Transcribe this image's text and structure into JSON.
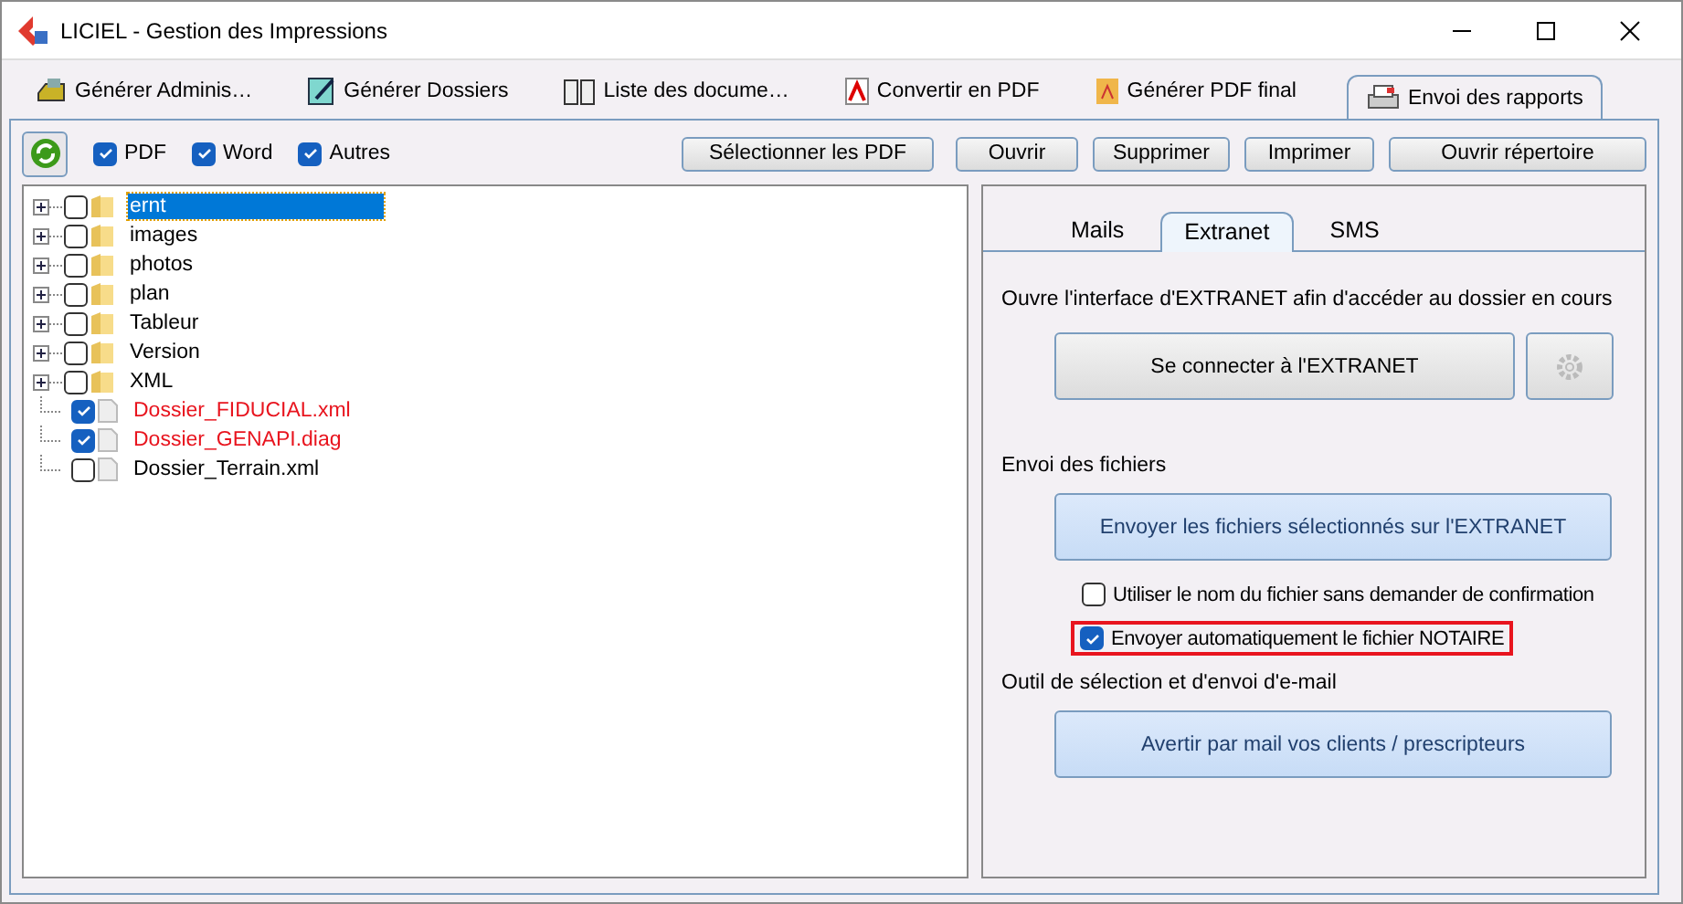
{
  "window": {
    "title": "LICIEL - Gestion des Impressions"
  },
  "tabs": [
    {
      "label": "Générer Adminis…",
      "selected": false
    },
    {
      "label": "Générer Dossiers",
      "selected": false
    },
    {
      "label": "Liste des docume…",
      "selected": false
    },
    {
      "label": "Convertir en PDF",
      "selected": false
    },
    {
      "label": "Générer PDF final",
      "selected": false
    },
    {
      "label": "Envoi des rapports",
      "selected": true
    }
  ],
  "filters": [
    {
      "label": "PDF",
      "checked": true
    },
    {
      "label": "Word",
      "checked": true
    },
    {
      "label": "Autres",
      "checked": true
    }
  ],
  "toolbar_buttons": [
    "Sélectionner les PDF",
    "Ouvrir",
    "Supprimer",
    "Imprimer",
    "Ouvrir répertoire"
  ],
  "tree": [
    {
      "kind": "folder",
      "label": "ernt",
      "checked": false,
      "selected": true,
      "flagged": false
    },
    {
      "kind": "folder",
      "label": "images",
      "checked": false,
      "selected": false,
      "flagged": false
    },
    {
      "kind": "folder",
      "label": "photos",
      "checked": false,
      "selected": false,
      "flagged": false
    },
    {
      "kind": "folder",
      "label": "plan",
      "checked": false,
      "selected": false,
      "flagged": false
    },
    {
      "kind": "folder",
      "label": "Tableur",
      "checked": false,
      "selected": false,
      "flagged": false
    },
    {
      "kind": "folder",
      "label": "Version",
      "checked": false,
      "selected": false,
      "flagged": false
    },
    {
      "kind": "folder",
      "label": "XML",
      "checked": false,
      "selected": false,
      "flagged": false
    },
    {
      "kind": "file",
      "label": "Dossier_FIDUCIAL.xml",
      "checked": true,
      "selected": false,
      "flagged": true
    },
    {
      "kind": "file",
      "label": "Dossier_GENAPI.diag",
      "checked": true,
      "selected": false,
      "flagged": true
    },
    {
      "kind": "file",
      "label": "Dossier_Terrain.xml",
      "checked": false,
      "selected": false,
      "flagged": false
    }
  ],
  "sub_tabs": [
    {
      "label": "Mails",
      "selected": false
    },
    {
      "label": "Extranet",
      "selected": true
    },
    {
      "label": "SMS",
      "selected": false
    }
  ],
  "extranet": {
    "intro": "Ouvre l'interface d'EXTRANET afin d'accéder au dossier en cours",
    "connect_button": "Se connecter à l'EXTRANET",
    "files_heading": "Envoi des fichiers",
    "send_button": "Envoyer les fichiers sélectionnés sur l'EXTRANET",
    "options": [
      {
        "label": "Utiliser le nom du fichier sans demander de confirmation",
        "checked": false,
        "highlighted": false
      },
      {
        "label": "Envoyer automatiquement le fichier NOTAIRE",
        "checked": true,
        "highlighted": true
      }
    ],
    "mail_heading": "Outil de sélection et d'envoi d'e-mail",
    "mail_button": "Avertir par mail vos clients / prescripteurs"
  }
}
